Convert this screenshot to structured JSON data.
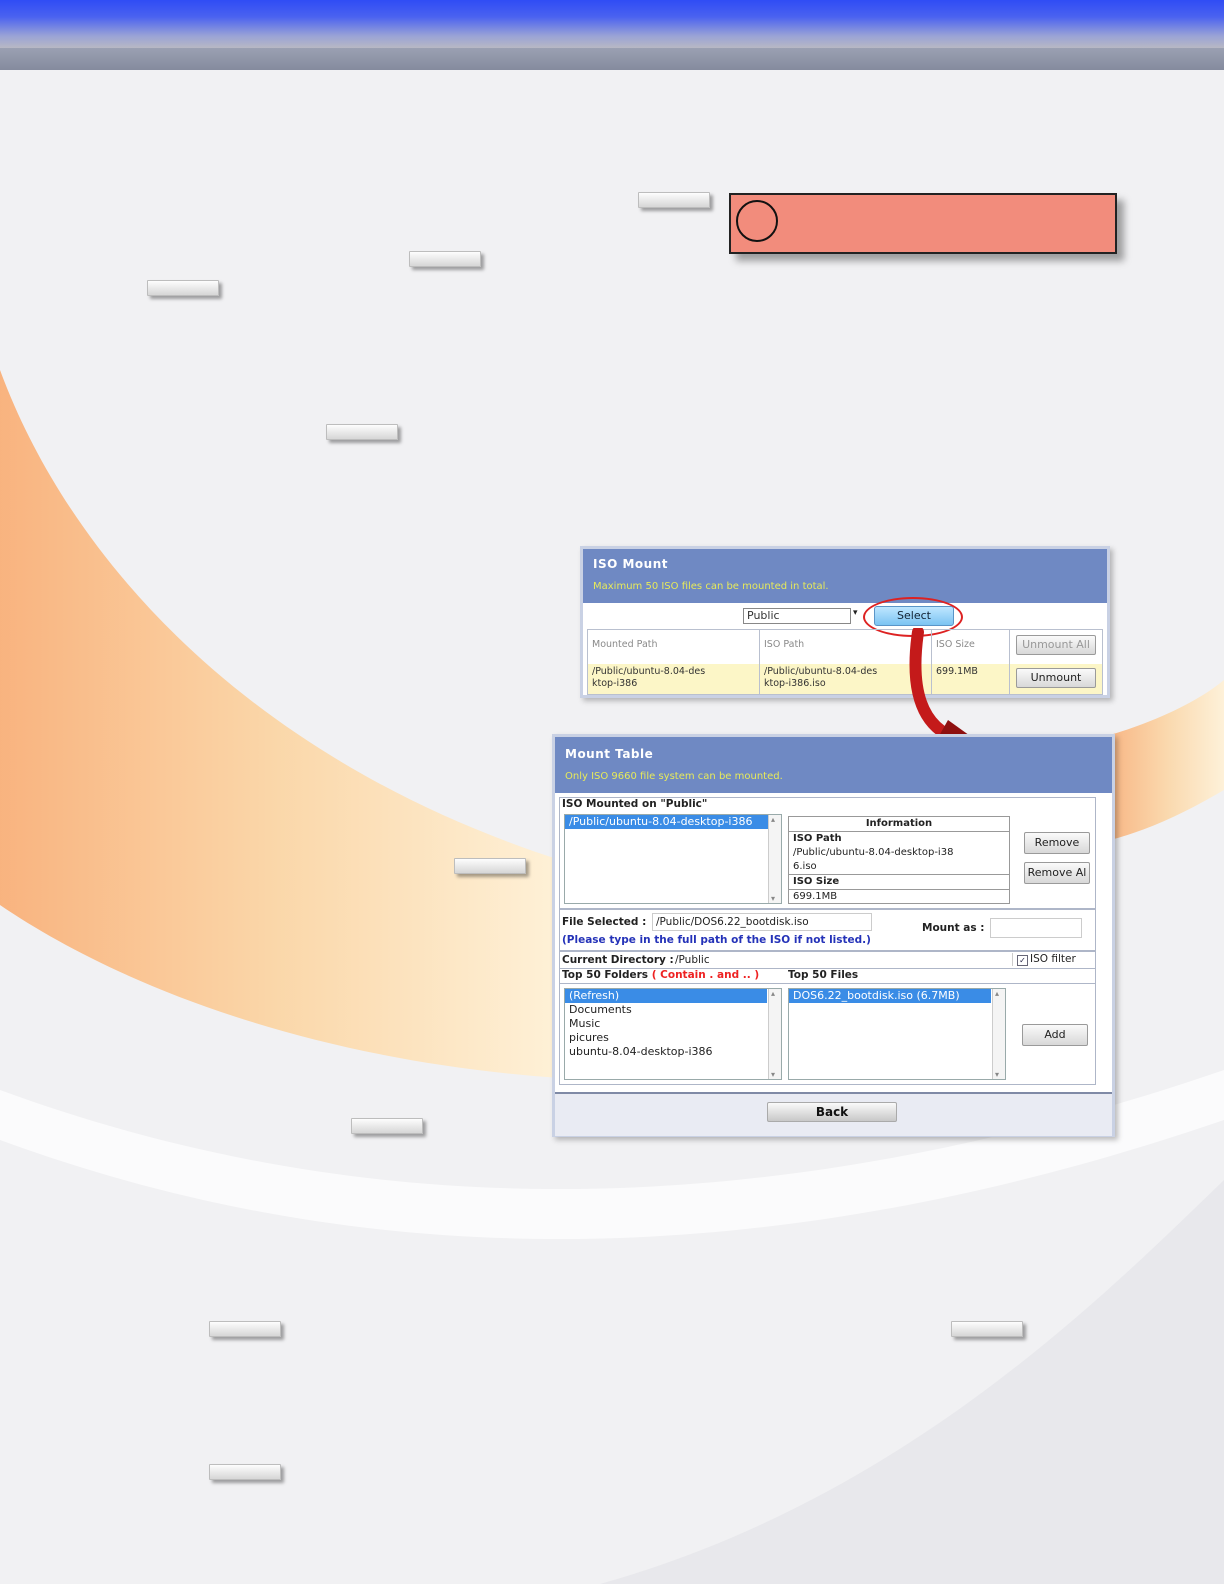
{
  "iso_mount": {
    "title": "ISO Mount",
    "subtitle": "Maximum 50 ISO files can be mounted in total.",
    "share_value": "Public",
    "select_label": "Select",
    "table": {
      "headers": [
        "Mounted Path",
        "ISO Path",
        "ISO Size"
      ],
      "unmount_all_label": "Unmount All",
      "rows": [
        {
          "mounted_path_1": "/Public/ubuntu-8.04-des",
          "mounted_path_2": "ktop-i386",
          "iso_path_1": "/Public/ubuntu-8.04-des",
          "iso_path_2": "ktop-i386.iso",
          "iso_size": "699.1MB",
          "action": "Unmount"
        }
      ]
    }
  },
  "mount_table": {
    "title": "Mount Table",
    "subtitle": "Only ISO 9660 file system can be mounted.",
    "mounted_on_label": "ISO Mounted on \"Public\"",
    "mounted_list": [
      "/Public/ubuntu-8.04-desktop-i386"
    ],
    "info": {
      "header": "Information",
      "iso_path_label": "ISO Path",
      "iso_path_1": "/Public/ubuntu-8.04-desktop-i38",
      "iso_path_2": "6.iso",
      "iso_size_label": "ISO Size",
      "iso_size": "699.1MB"
    },
    "remove_label": "Remove",
    "remove_all_label": "Remove Al",
    "file_selected_label": "File Selected :",
    "file_selected_value": "/Public/DOS6.22_bootdisk.iso",
    "hint": "(Please type in the full path of the ISO if not listed.)",
    "mount_as_label": "Mount as :",
    "current_dir_label": "Current Directory :",
    "current_dir_value": "/Public",
    "iso_filter_label": "ISO filter",
    "folders_label": "Top 50 Folders",
    "folders_note": "( Contain . and .. )",
    "files_label": "Top 50 Files",
    "folders": [
      "(Refresh)",
      "Documents",
      "Music",
      "picures",
      "ubuntu-8.04-desktop-i386"
    ],
    "files": [
      "DOS6.22_bootdisk.iso (6.7MB)"
    ],
    "add_label": "Add",
    "back_label": "Back"
  },
  "colors": {
    "panel_header": "#6f89c3",
    "subtitle_text": "#e7ea5a",
    "callout": "#f28c7c",
    "arrow": "#c41a1a",
    "selection": "#3a8ce6"
  }
}
